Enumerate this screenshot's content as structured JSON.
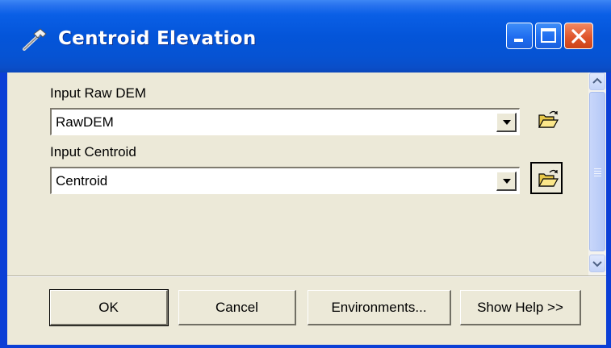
{
  "window": {
    "title": "Centroid Elevation",
    "icon": "hammer-icon",
    "controls": [
      "minimize-icon",
      "maximize-icon",
      "close-icon"
    ]
  },
  "parameters": [
    {
      "label": "Input Raw DEM",
      "value": "RawDEM",
      "browse_icon": "open-folder-icon"
    },
    {
      "label": "Input Centroid",
      "value": "Centroid",
      "browse_icon": "open-folder-icon"
    }
  ],
  "buttons": {
    "ok": "OK",
    "cancel": "Cancel",
    "environments": "Environments...",
    "show_help": "Show Help >>"
  },
  "colors": {
    "titlebar": "#0455d9",
    "dialog_face": "#ece9d8",
    "close_button": "#e0562c"
  }
}
